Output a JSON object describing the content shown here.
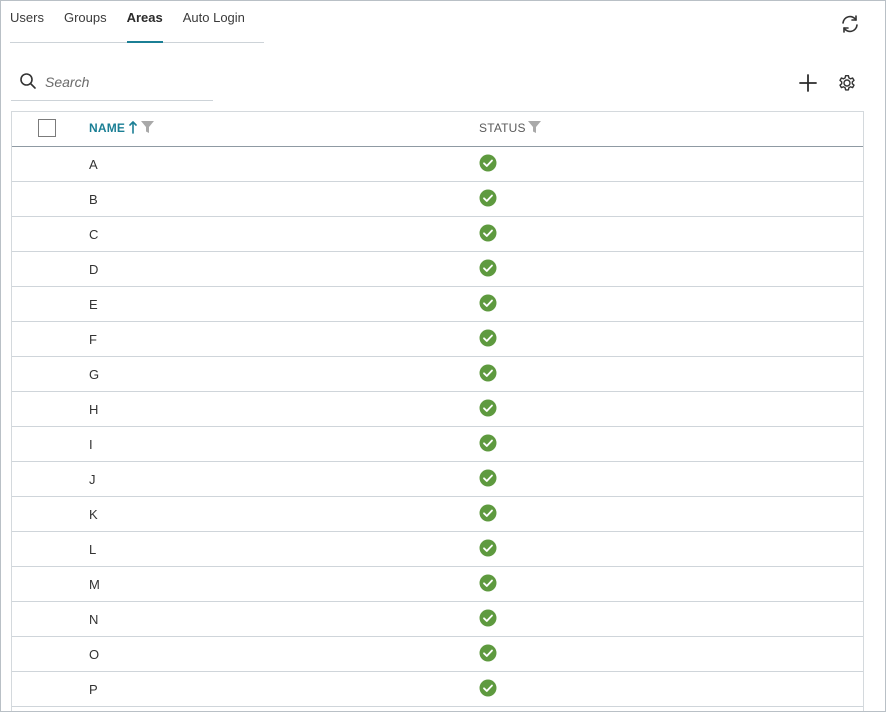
{
  "tabs": [
    {
      "label": "Users",
      "active": false
    },
    {
      "label": "Groups",
      "active": false
    },
    {
      "label": "Areas",
      "active": true
    },
    {
      "label": "Auto Login",
      "active": false
    }
  ],
  "search": {
    "placeholder": "Search",
    "value": ""
  },
  "icons": {
    "refresh": "refresh-icon",
    "search": "search-icon",
    "add": "plus-icon",
    "settings": "gear-icon",
    "sort": "sort-ascending-icon",
    "filter": "filter-icon",
    "status_ok": "check-circle-icon"
  },
  "colors": {
    "accent": "#1b7f95",
    "status_ok": "#5e9a3f"
  },
  "table": {
    "columns": {
      "name": "NAME",
      "status": "STATUS"
    },
    "rows": [
      {
        "name": "A",
        "status": "ok"
      },
      {
        "name": "B",
        "status": "ok"
      },
      {
        "name": "C",
        "status": "ok"
      },
      {
        "name": "D",
        "status": "ok"
      },
      {
        "name": "E",
        "status": "ok"
      },
      {
        "name": "F",
        "status": "ok"
      },
      {
        "name": "G",
        "status": "ok"
      },
      {
        "name": "H",
        "status": "ok"
      },
      {
        "name": "I",
        "status": "ok"
      },
      {
        "name": "J",
        "status": "ok"
      },
      {
        "name": "K",
        "status": "ok"
      },
      {
        "name": "L",
        "status": "ok"
      },
      {
        "name": "M",
        "status": "ok"
      },
      {
        "name": "N",
        "status": "ok"
      },
      {
        "name": "O",
        "status": "ok"
      },
      {
        "name": "P",
        "status": "ok"
      }
    ]
  }
}
